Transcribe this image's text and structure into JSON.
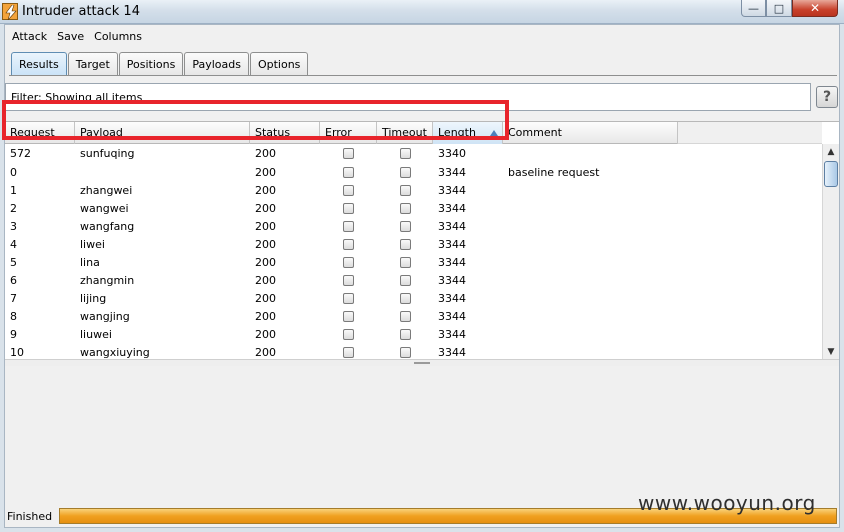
{
  "window": {
    "title": "Intruder attack 14",
    "controls": {
      "minimize": "—",
      "maximize": "□",
      "close": "✕"
    }
  },
  "menu": [
    "Attack",
    "Save",
    "Columns"
  ],
  "tabs": [
    {
      "label": "Results",
      "active": true
    },
    {
      "label": "Target",
      "active": false
    },
    {
      "label": "Positions",
      "active": false
    },
    {
      "label": "Payloads",
      "active": false
    },
    {
      "label": "Options",
      "active": false
    }
  ],
  "filter": {
    "text": "Filter:  Showing all items",
    "help_label": "?"
  },
  "table": {
    "columns": [
      "Request",
      "Payload",
      "Status",
      "Error",
      "Timeout",
      "Length",
      "Comment"
    ],
    "sorted_column": "Length",
    "rows": [
      {
        "request": "572",
        "payload": "sunfuqing",
        "status": "200",
        "error": false,
        "timeout": false,
        "length": "3340",
        "comment": ""
      },
      {
        "request": "0",
        "payload": "",
        "status": "200",
        "error": false,
        "timeout": false,
        "length": "3344",
        "comment": "baseline request"
      },
      {
        "request": "1",
        "payload": "zhangwei",
        "status": "200",
        "error": false,
        "timeout": false,
        "length": "3344",
        "comment": ""
      },
      {
        "request": "2",
        "payload": "wangwei",
        "status": "200",
        "error": false,
        "timeout": false,
        "length": "3344",
        "comment": ""
      },
      {
        "request": "3",
        "payload": "wangfang",
        "status": "200",
        "error": false,
        "timeout": false,
        "length": "3344",
        "comment": ""
      },
      {
        "request": "4",
        "payload": "liwei",
        "status": "200",
        "error": false,
        "timeout": false,
        "length": "3344",
        "comment": ""
      },
      {
        "request": "5",
        "payload": "lina",
        "status": "200",
        "error": false,
        "timeout": false,
        "length": "3344",
        "comment": ""
      },
      {
        "request": "6",
        "payload": "zhangmin",
        "status": "200",
        "error": false,
        "timeout": false,
        "length": "3344",
        "comment": ""
      },
      {
        "request": "7",
        "payload": "lijing",
        "status": "200",
        "error": false,
        "timeout": false,
        "length": "3344",
        "comment": ""
      },
      {
        "request": "8",
        "payload": "wangjing",
        "status": "200",
        "error": false,
        "timeout": false,
        "length": "3344",
        "comment": ""
      },
      {
        "request": "9",
        "payload": "liuwei",
        "status": "200",
        "error": false,
        "timeout": false,
        "length": "3344",
        "comment": ""
      },
      {
        "request": "10",
        "payload": "wangxiuying",
        "status": "200",
        "error": false,
        "timeout": false,
        "length": "3344",
        "comment": ""
      }
    ]
  },
  "status": {
    "text": "Finished",
    "progress_percent": 100
  },
  "watermark": "www.wooyun.org",
  "colors": {
    "highlight": "#e8242b",
    "progress": "#f0a020",
    "active_tab": "#c9e2f7"
  },
  "icons": {
    "app": "burp-lightning-icon",
    "sort": "sort-ascending-icon"
  }
}
